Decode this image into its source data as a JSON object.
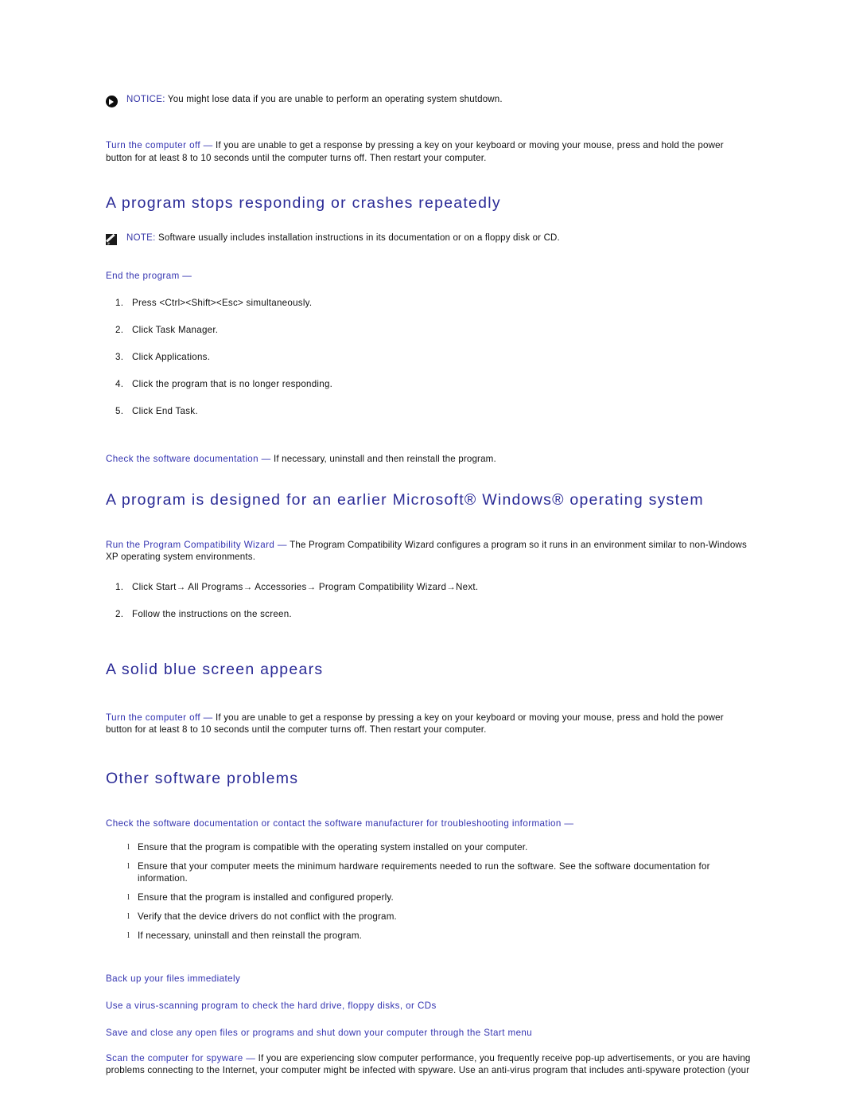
{
  "colors": {
    "heading_blue": "#2a2a96",
    "lead_blue": "#3333b0",
    "body_black": "#111111",
    "page_background": "#ffffff"
  },
  "notice_block": {
    "icon": "notice-arrow-icon",
    "label": "NOTICE:",
    "text": " You might lose data if you are unable to perform an operating system shutdown."
  },
  "turn_off_top": {
    "lead": "Turn the computer off —",
    "body": " If you are unable to get a response by pressing a key on your keyboard or moving your mouse, press and hold the power button for at least 8 to 10 seconds until the computer turns off. Then restart your computer."
  },
  "section_program_stops": {
    "title": "A program stops responding or crashes repeatedly",
    "note": {
      "icon": "note-pencil-icon",
      "label": "NOTE:",
      "text": " Software usually includes installation instructions in its documentation or on a floppy disk or CD."
    },
    "subhead": "End the program —",
    "steps": [
      {
        "num": "1.",
        "text": "Press <Ctrl><Shift><Esc> simultaneously."
      },
      {
        "num": "2.",
        "text": "Click Task Manager."
      },
      {
        "num": "3.",
        "text": "Click Applications."
      },
      {
        "num": "4.",
        "text": "Click the program that is no longer responding."
      },
      {
        "num": "5.",
        "text": "Click End Task."
      }
    ],
    "check_docs": {
      "lead": "Check the software documentation —",
      "body": " If necessary, uninstall and then reinstall the program."
    }
  },
  "section_earlier_windows": {
    "title": "A program is designed for an earlier Microsoft® Windows® operating system",
    "wizard": {
      "lead": "Run the Program Compatibility Wizard —",
      "body": " The Program Compatibility Wizard configures a program so it runs in an environment similar to non-Windows XP operating system environments."
    },
    "steps": [
      {
        "num": "1.",
        "text": "Click Start→ All Programs→ Accessories→ Program Compatibility Wizard→Next."
      },
      {
        "num": "2.",
        "text": "Follow the instructions on the screen."
      }
    ]
  },
  "section_blue_screen": {
    "title": "A solid blue screen appears",
    "turn_off": {
      "lead": "Turn the computer off —",
      "body": " If you are unable to get a response by pressing a key on your keyboard or moving your mouse, press and hold the power button for at least 8 to 10 seconds until the computer turns off. Then restart your computer."
    }
  },
  "section_other_software": {
    "title": "Other software problems",
    "check_docs_lead": "Check the software documentation or contact the software manufacturer for troubleshooting information —",
    "bullet_marker": "l",
    "bullets": [
      "Ensure that the program is compatible with the operating system installed on your computer.",
      "Ensure that your computer meets the minimum hardware requirements needed to run the software. See the software documentation for information.",
      "Ensure that the program is installed and configured properly.",
      "Verify that the device drivers do not conflict with the program.",
      "If necessary, uninstall and then reinstall the program."
    ],
    "tips": [
      "Back up your files immediately",
      "Use a virus-scanning program to check the hard drive, floppy disks, or CDs",
      "Save and close any open files or programs and shut down your computer through the Start menu"
    ],
    "spyware": {
      "lead": "Scan the computer for spyware —",
      "body": " If you are experiencing slow computer performance, you frequently receive pop-up advertisements, or you are having problems connecting to the Internet, your computer might be infected with spyware. Use an anti-virus program that includes anti-spyware protection (your"
    }
  }
}
